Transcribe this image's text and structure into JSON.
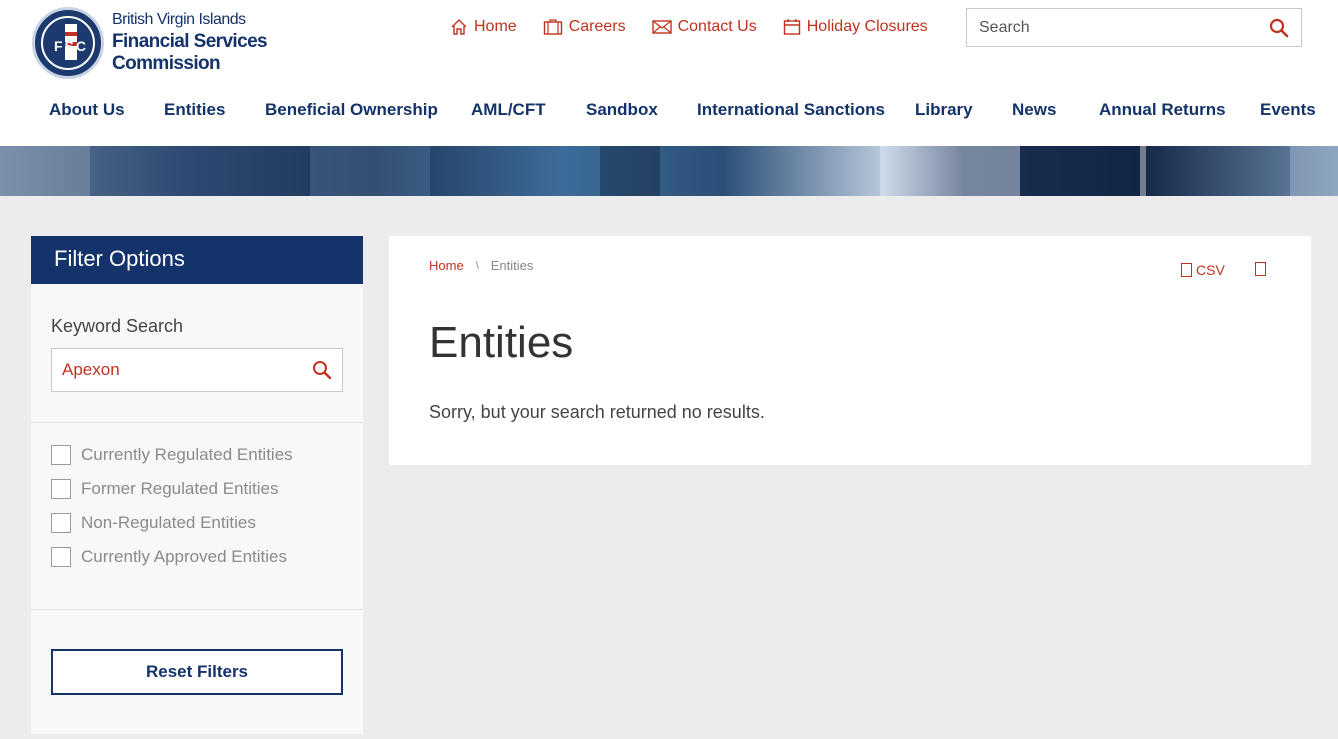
{
  "logo": {
    "seal_text": "FSC",
    "line1": "British Virgin Islands",
    "line2": "Financial Services Commission"
  },
  "utility_nav": [
    {
      "label": "Home",
      "icon": "home-icon"
    },
    {
      "label": "Careers",
      "icon": "briefcase-icon"
    },
    {
      "label": "Contact Us",
      "icon": "envelope-icon"
    },
    {
      "label": "Holiday Closures",
      "icon": "calendar-icon"
    }
  ],
  "search": {
    "placeholder": "Search",
    "icon": "search-icon"
  },
  "main_nav": [
    "About Us",
    "Entities",
    "Beneficial Ownership",
    "AML/CFT",
    "Sandbox",
    "International Sanctions",
    "Library",
    "News",
    "Annual Returns",
    "Events"
  ],
  "sidebar": {
    "title": "Filter Options",
    "keyword_label": "Keyword Search",
    "keyword_value": "Apexon",
    "filters": [
      "Currently Regulated Entities",
      "Former Regulated Entities",
      "Non-Regulated Entities",
      "Currently Approved Entities"
    ],
    "reset_label": "Reset Filters"
  },
  "content": {
    "breadcrumb": {
      "home": "Home",
      "separator": "\\",
      "current": "Entities"
    },
    "csv_label": "CSV",
    "title": "Entities",
    "message": "Sorry, but your search returned no results."
  },
  "colors": {
    "navy": "#14336a",
    "accent": "#c0321f",
    "background": "#ececec"
  }
}
